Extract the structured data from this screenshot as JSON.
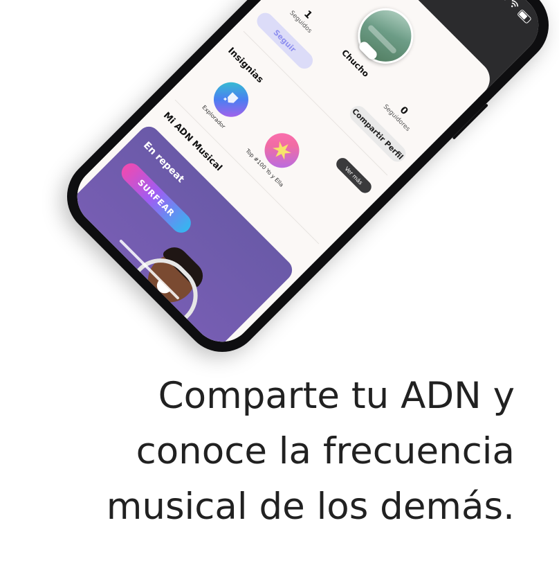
{
  "profile": {
    "username": "Chucho",
    "following_count": "1",
    "following_label": "Seguidos",
    "followers_count": "0",
    "followers_label": "Seguidores",
    "follow_button": "Seguir",
    "share_button": "Compartir Perfil"
  },
  "badges": {
    "title": "Insignias",
    "see_more": "Ver más",
    "items": [
      {
        "label": "Explorador"
      },
      {
        "label": "Top #100 Yo y Ella"
      }
    ]
  },
  "dna": {
    "title": "Mi ADN Musical",
    "card_title": "En repeat",
    "card_button": "SURFEAR"
  },
  "caption": {
    "line1": "Comparte tu ADN y",
    "line2": "conoce la frecuencia",
    "line3": "musical de los demás."
  },
  "icons": {
    "status": [
      "signal-icon",
      "wifi-icon",
      "battery-icon"
    ],
    "badge_explorer": "explorer-badge-icon",
    "badge_top": "star-badge-icon"
  },
  "colors": {
    "follow_bg": "#dcdcf8",
    "follow_text": "#8f90ef",
    "card_gradient_start": "#6a5aa8",
    "surf_gradient": [
      "#f04ab0",
      "#a05cf2",
      "#34b7f0"
    ]
  }
}
